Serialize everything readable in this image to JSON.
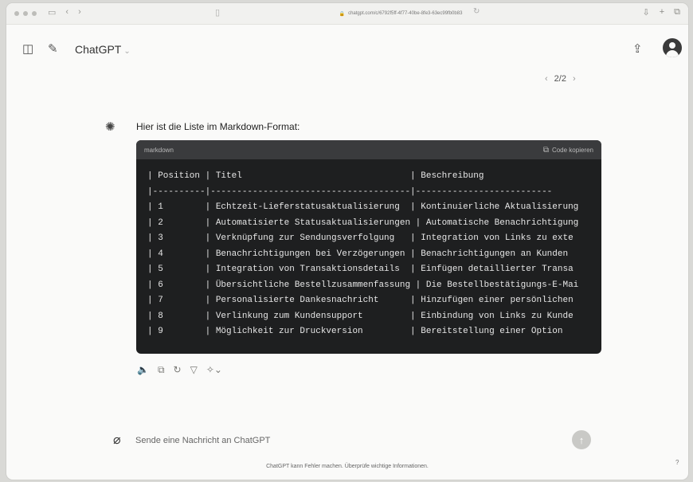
{
  "browser": {
    "url": "chatgpt.com/c/6792f5ff-4f77-40be-8fe3-63ec99fb0b83",
    "back_icon": "chevron-left-icon",
    "forward_icon": "chevron-right-icon"
  },
  "header": {
    "title": "ChatGPT",
    "sidebar_icon": "sidebar-icon",
    "new_chat_icon": "edit-icon",
    "share_icon": "share-icon",
    "avatar_icon": "user-icon"
  },
  "pager": {
    "label": "2/2"
  },
  "message": {
    "intro": "Hier ist die Liste im Markdown-Format:",
    "code": {
      "language": "markdown",
      "copy_label": "Code kopieren",
      "lines": [
        "| Position | Titel                                | Beschreibung",
        "|----------|--------------------------------------|--------------------------",
        "| 1        | Echtzeit-Lieferstatusaktualisierung  | Kontinuierliche Aktualisierung",
        "| 2        | Automatisierte Statusaktualisierungen | Automatische Benachrichtigung",
        "| 3        | Verknüpfung zur Sendungsverfolgung   | Integration von Links zu exte",
        "| 4        | Benachrichtigungen bei Verzögerungen | Benachrichtigungen an Kunden",
        "| 5        | Integration von Transaktionsdetails  | Einfügen detaillierter Transa",
        "| 6        | Übersichtliche Bestellzusammenfassung | Die Bestellbestätigungs-E-Mai",
        "| 7        | Personalisierte Dankesnachricht      | Hinzufügen einer persönlichen",
        "| 8        | Verlinkung zum Kundensupport         | Einbindung von Links zu Kunde",
        "| 9        | Möglichkeit zur Druckversion         | Bereitstellung einer Option"
      ]
    }
  },
  "composer": {
    "placeholder": "Sende eine Nachricht an ChatGPT"
  },
  "footer": {
    "disclaimer": "ChatGPT kann Fehler machen. Überprüfe wichtige Informationen.",
    "help": "?"
  }
}
